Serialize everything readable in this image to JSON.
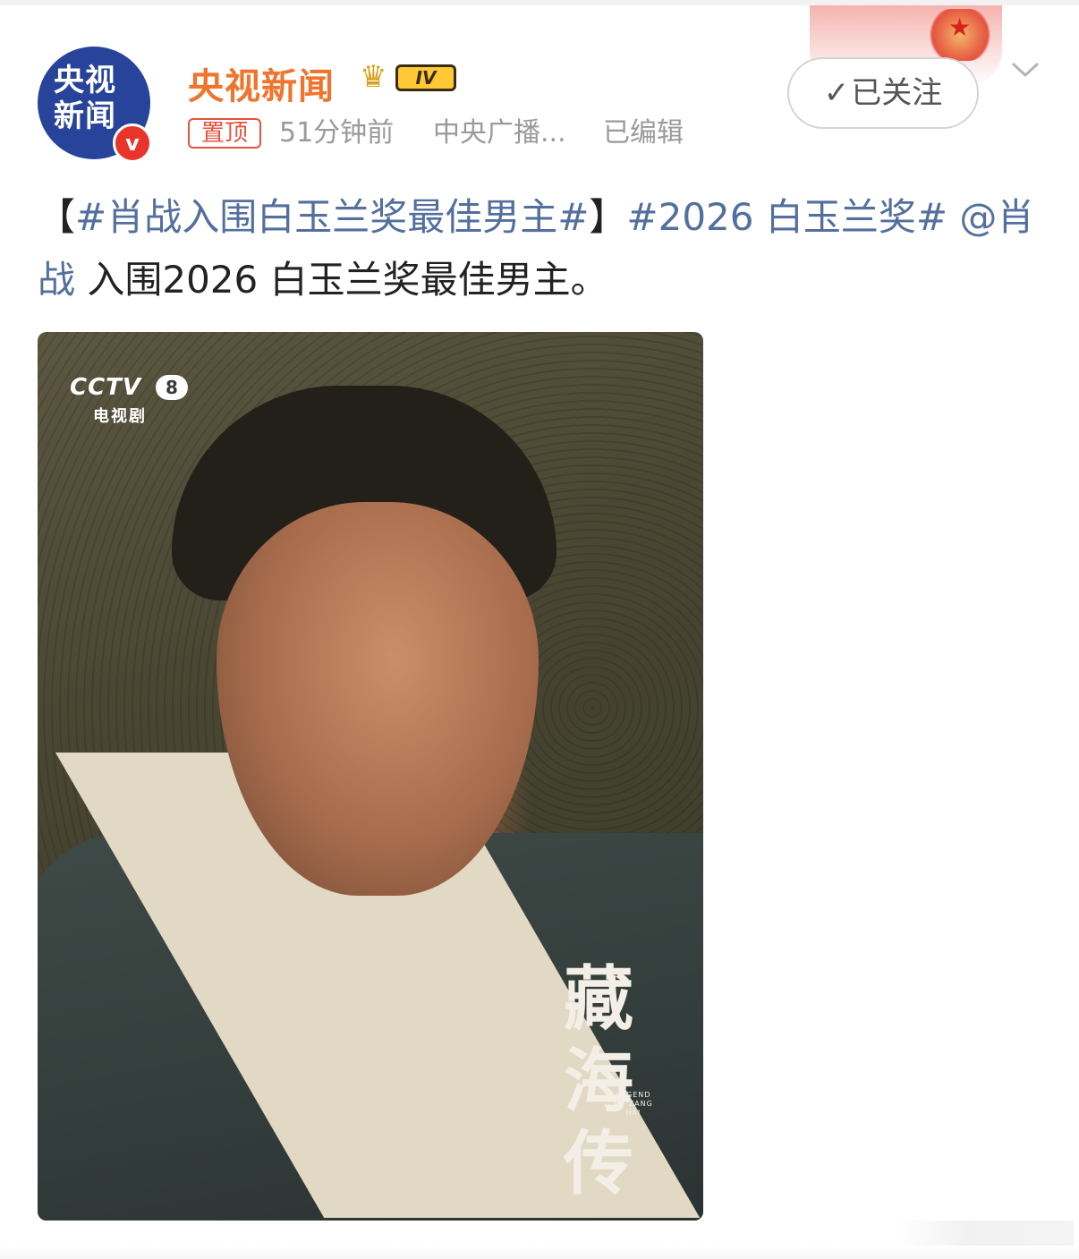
{
  "colors": {
    "username": "#f0742b",
    "link": "#536f9e",
    "pin": "#e4533f",
    "avatar_bg": "#27439a",
    "verify_badge": "#e9342b",
    "meta_gray": "#9a9a9a"
  },
  "header": {
    "avatar_text": "央视新闻",
    "verify_glyph": "v",
    "username": "央视新闻",
    "vip_label": "IV",
    "pinned_label": "置顶",
    "time": "51分钟前",
    "source": "中央广播...",
    "edited": "已编辑",
    "follow_label": "已关注"
  },
  "post": {
    "bracket_open": "【",
    "topic1": "#肖战入围白玉兰奖最佳男主#",
    "bracket_close": "】",
    "topic2": "#2026 白玉兰奖#",
    "mention": "@肖战",
    "body": " 入围2026 白玉兰奖最佳男主。"
  },
  "poster": {
    "channel_logo": "CCTV",
    "channel_number": "8",
    "channel_sub": "电视剧",
    "title_chars": [
      "藏",
      "海",
      "传"
    ],
    "title_en": "LEGEND OF ZANG HAI"
  }
}
